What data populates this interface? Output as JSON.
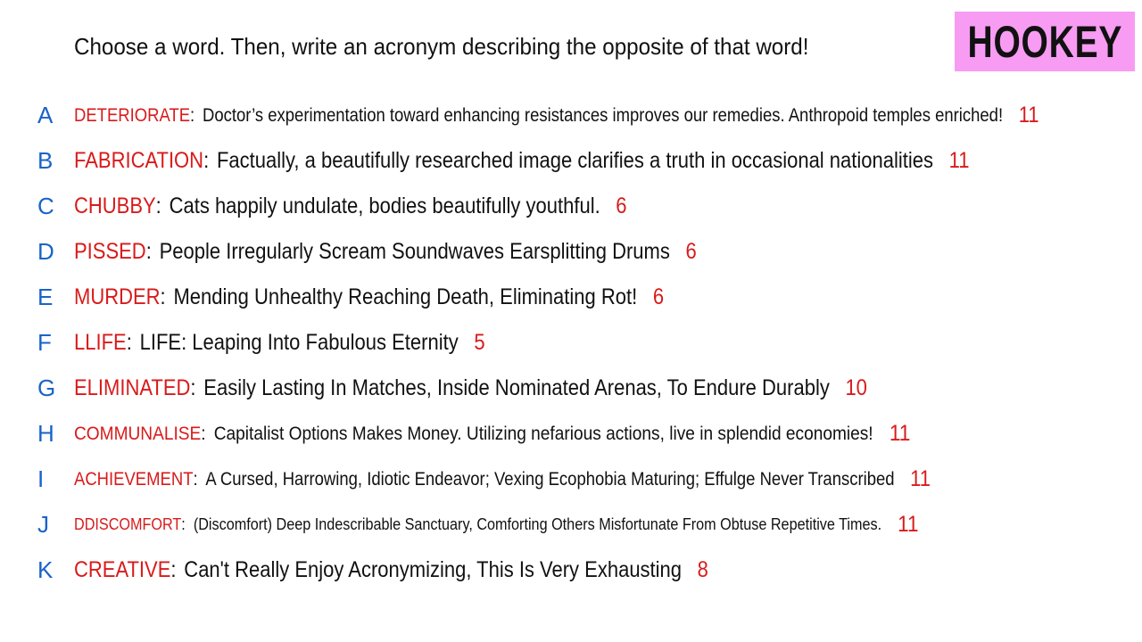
{
  "header": {
    "prompt": "Choose a word. Then, write an acronym describing the opposite of that word!",
    "logo": "HOOKEY"
  },
  "colors": {
    "letter": "#1a63c8",
    "word": "#d91a1a",
    "logo_bg": "#f79cf2"
  },
  "entries": [
    {
      "letter": "A",
      "word": "DETERIORATE",
      "acronym": "Doctor’s experimentation toward enhancing resistances improves our remedies. Anthropoid temples enriched!",
      "count": "11"
    },
    {
      "letter": "B",
      "word": "FABRICATION",
      "acronym": "Factually, a beautifully researched image clarifies a truth in occasional nationalities",
      "count": "11"
    },
    {
      "letter": "C",
      "word": "CHUBBY",
      "acronym": "Cats happily undulate, bodies beautifully youthful.",
      "count": "6"
    },
    {
      "letter": "D",
      "word": "PISSED",
      "acronym": "People Irregularly Scream Soundwaves Earsplitting Drums",
      "count": "6"
    },
    {
      "letter": "E",
      "word": "MURDER",
      "acronym": "Mending Unhealthy Reaching Death, Eliminating Rot!",
      "count": "6"
    },
    {
      "letter": "F",
      "word": "LLIFE",
      "acronym": "LIFE: Leaping Into Fabulous Eternity",
      "count": "5"
    },
    {
      "letter": "G",
      "word": "ELIMINATED",
      "acronym": "Easily Lasting In Matches, Inside Nominated Arenas, To Endure Durably",
      "count": "10"
    },
    {
      "letter": "H",
      "word": "COMMUNALISE",
      "acronym": "Capitalist Options Makes Money. Utilizing nefarious actions, live in splendid economies!",
      "count": "11"
    },
    {
      "letter": "I",
      "word": "ACHIEVEMENT",
      "acronym": "A Cursed, Harrowing, Idiotic Endeavor; Vexing Ecophobia Maturing; Effulge Never Transcribed",
      "count": "11"
    },
    {
      "letter": "J",
      "word": "DDISCOMFORT",
      "acronym": "(Discomfort) Deep Indescribable Sanctuary, Comforting Others Misfortunate From Obtuse Repetitive Times.",
      "count": "11"
    },
    {
      "letter": "K",
      "word": "CREATIVE",
      "acronym": "Can't Really Enjoy Acronymizing, This Is Very Exhausting",
      "count": "8"
    }
  ]
}
